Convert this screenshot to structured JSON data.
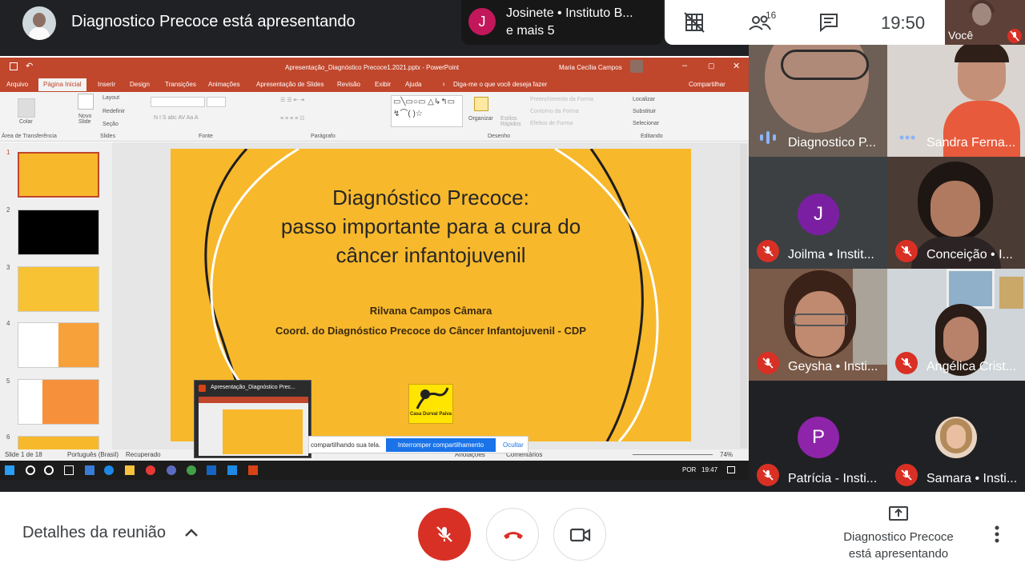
{
  "header": {
    "presenting_title": "Diagnostico Precoce está apresentando",
    "notification": {
      "avatar_letter": "J",
      "line1": "Josinete • Instituto B...",
      "line2": "e mais 5"
    },
    "participant_count": "16",
    "time": "19:50",
    "self_label": "Você"
  },
  "powerpoint": {
    "window_title": "Apresentação_Diagnóstico Precoce1.2021.pptx - PowerPoint",
    "user": "Maria Cecília Campos",
    "tabs": [
      "Arquivo",
      "Página Inicial",
      "Inserir",
      "Design",
      "Transições",
      "Animações",
      "Apresentação de Slides",
      "Revisão",
      "Exibir",
      "Ajuda",
      "Diga-me o que você deseja fazer",
      "Compartilhar"
    ],
    "ribbon_groups": [
      "Área de Transferência",
      "Slides",
      "Fonte",
      "Parágrafo",
      "Desenho",
      "Editando"
    ],
    "ribbon_items": [
      "Colar",
      "Novo Slide",
      "Layout",
      "Redefinir",
      "Seção",
      "Organizar",
      "Estilos Rápidos",
      "Preenchimento da Forma",
      "Contorno da Forma",
      "Efeitos de Forma",
      "Localizar",
      "Substituir",
      "Selecionar"
    ],
    "thumb_numbers": [
      "1",
      "2",
      "3",
      "4",
      "5",
      "6"
    ],
    "slide": {
      "title_line1": "Diagnóstico Precoce:",
      "title_line2": "passo importante para a cura do",
      "title_line3": "câncer infantojuvenil",
      "author": "Rilvana Campos Câmara",
      "role": "Coord. do Diagnóstico Precoce do Câncer Infantojuvenil - CDP",
      "logo_text": "Casa Durval Paiva"
    },
    "status": {
      "slide_count": "Slide 1 de 18",
      "language": "Português (Brasil)",
      "recovered": "Recuperado",
      "notes": "Anotações",
      "comments": "Comentários",
      "zoom": "74%"
    },
    "taskbar": {
      "lang": "POR",
      "time": "19:47"
    },
    "preview_title": "Apresentação_Diagnóstico Prec...",
    "share_bar": {
      "text": "compartilhando sua tela.",
      "stop_button": "Interromper compartilhamento",
      "hide": "Ocultar"
    }
  },
  "participants": [
    {
      "name": "Diagnostico P...",
      "muted": false,
      "speaking": true
    },
    {
      "name": "Sandra Ferna...",
      "muted": false,
      "speaking": false
    },
    {
      "name": "Joilma • Instit...",
      "muted": true,
      "avatar": "J",
      "color": "#7b1fa2"
    },
    {
      "name": "Conceição • I...",
      "muted": true
    },
    {
      "name": "Geysha • Insti...",
      "muted": true
    },
    {
      "name": "Angélica Crist...",
      "muted": true
    },
    {
      "name": "Patrícia - Insti...",
      "muted": true,
      "avatar": "P",
      "color": "#8e24aa"
    },
    {
      "name": "Samara • Insti...",
      "muted": true
    }
  ],
  "bottom": {
    "details": "Detalhes da reunião",
    "presenting_line1": "Diagnostico Precoce",
    "presenting_line2": "está apresentando"
  },
  "colors": {
    "mute_red": "#d93025",
    "slide_yellow": "#f7b82b",
    "ppt_orange": "#c0462c"
  }
}
